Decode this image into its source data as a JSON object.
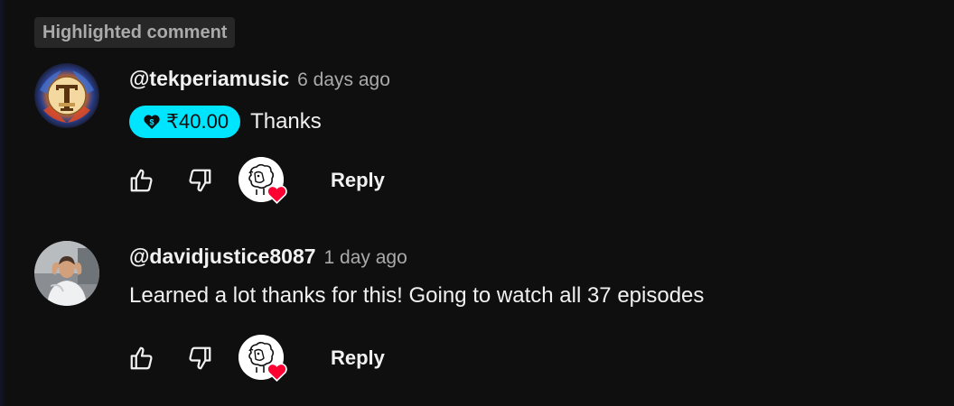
{
  "highlighted_label": "Highlighted comment",
  "colors": {
    "background": "#0f0f0f",
    "thanks_chip": "#00e5ff",
    "heart": "#ff0033",
    "secondary_text": "#aaaaaa"
  },
  "comments": [
    {
      "author": "@tekperiamusic",
      "timestamp": "6 days ago",
      "thanks_amount": "₹40.00",
      "text": "Thanks",
      "avatar_icon": "tekperia-logo-avatar",
      "creator_hearted": true,
      "reply_label": "Reply"
    },
    {
      "author": "@davidjustice8087",
      "timestamp": "1 day ago",
      "text": "Learned a lot thanks for this! Going to watch all 37 episodes",
      "avatar_icon": "user-photo-avatar",
      "creator_hearted": true,
      "reply_label": "Reply"
    }
  ]
}
